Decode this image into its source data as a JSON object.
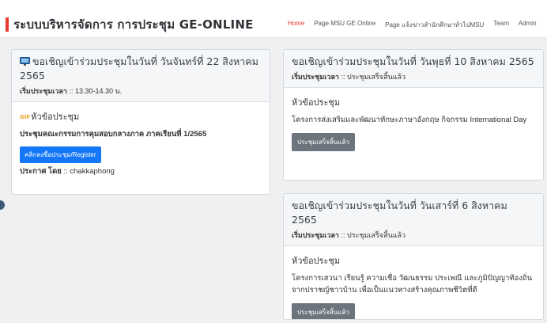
{
  "header": {
    "title": "ระบบบริหารจัดการ การประชุม GE-ONLINE",
    "nav_items": [
      {
        "label": "Home",
        "active": true
      },
      {
        "label": "Page MSU GE Online",
        "active": false
      },
      {
        "label": "Page แจ้งข่าวสำนักศึกษาทั่วไปMSU",
        "active": false
      },
      {
        "label": "Team",
        "active": false
      },
      {
        "label": "Admin",
        "active": false
      }
    ],
    "accent_color": "#e63a2e"
  },
  "meetings": [
    {
      "title": "ขอเชิญเข้าร่วมประชุมในวันที่ วันจันทร์ที่ 22 สิงหาคม 2565",
      "time_label": "เริ่มประชุมเวลา",
      "time_value": ":: 13.30-14.30 น.",
      "topic_label": "หัวข้อประชุม",
      "topic_text": "ประชุมคณะกรรมการคุมสอบกลางภาค ภาคเรียนที่ 1/2565",
      "button_label": "คลิกลงชื่อประชุม/Register",
      "posted_label": "ประกาศ โดย",
      "posted_value": ":: chakkaphong"
    },
    {
      "title": "ขอเชิญเข้าร่วมประชุมในวันที่ วันพุธที่ 10 สิงหาคม 2565",
      "time_label": "เริ่มประชุมเวลา",
      "time_value": ":: ประชุมเสร็จสิ้นแล้ว",
      "topic_label": "หัวข้อประชุม",
      "topic_text": "โครงการส่งเสริมและพัฒนาทักษะภาษาอังกฤษ กิจกรรม International Day",
      "button_label": "ประชุมเสร็จสิ้นแล้ว"
    },
    {
      "title": "ขอเชิญเข้าร่วมประชุมในวันที่ วันเสาร์ที่ 6 สิงหาคม 2565",
      "time_label": "เริ่มประชุมเวลา",
      "time_value": ":: ประชุมเสร็จสิ้นแล้ว",
      "topic_label": "หัวข้อประชุม",
      "topic_text": "โครงการเสวนา เรียนรู้ ความเชื่อ วัฒนธรรม ประเพณี และภูมิปัญญาท้องถิ่นจากปราชญ์ชาวบ้าน เพื่อเป็นแนวทางสร้างคุณภาพชีวิตที่ดี",
      "button_label": "ประชุมเสร็จสิ้นแล้ว"
    }
  ],
  "icons": {
    "meeting_icon": "monitor-icon",
    "topic_icon": "gif-icon"
  }
}
